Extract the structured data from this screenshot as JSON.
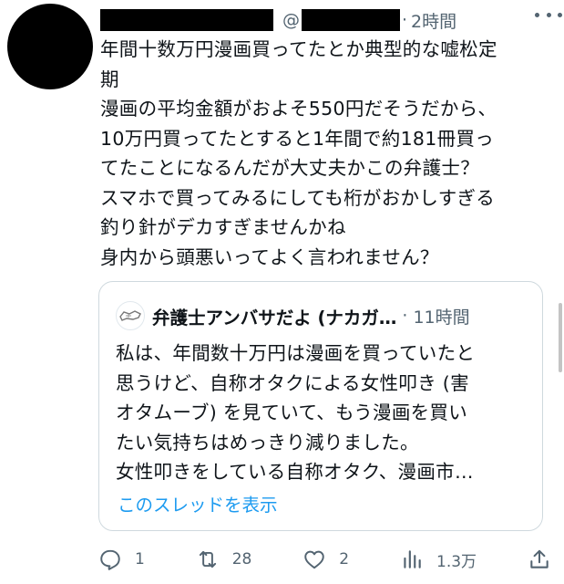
{
  "tweet": {
    "at_sign": "@",
    "time": "2時間",
    "lines": [
      "年間十数万円漫画買ってたとか典型的な嘘松定",
      "期",
      "漫画の平均金額がおよそ550円だそうだから、",
      "10万円買ってたとすると1年間で約181冊買っ",
      "てたことになるんだが大丈夫かこの弁護士？",
      "スマホで買ってみるにしても桁がおかしすぎる",
      "釣り針がデカすぎませんかね",
      "身内から頭悪いってよく言われません？"
    ]
  },
  "quote": {
    "name": "弁護士アンバサだよ (ナカガ…",
    "time": "11時間",
    "lines": [
      "私は、年間数十万円は漫画を買っていたと",
      "思うけど、自称オタクによる女性叩き (害",
      "オタムーブ) を見ていて、もう漫画を買い",
      "たい気持ちはめっきり減りました。",
      "女性叩きをしている自称オタク、漫画市…"
    ],
    "show_thread": "このスレッドを表示"
  },
  "actions": {
    "reply_count": "1",
    "retweet_count": "28",
    "like_count": "2",
    "views_count": "1.3万"
  },
  "icons": {
    "more": "more-icon",
    "reply": "reply-icon",
    "retweet": "retweet-icon",
    "like": "heart-icon",
    "views": "views-icon",
    "share": "share-icon"
  },
  "colors": {
    "text": "#0f1419",
    "muted": "#536471",
    "link": "#1d9bf0",
    "border": "#cfd9de"
  }
}
